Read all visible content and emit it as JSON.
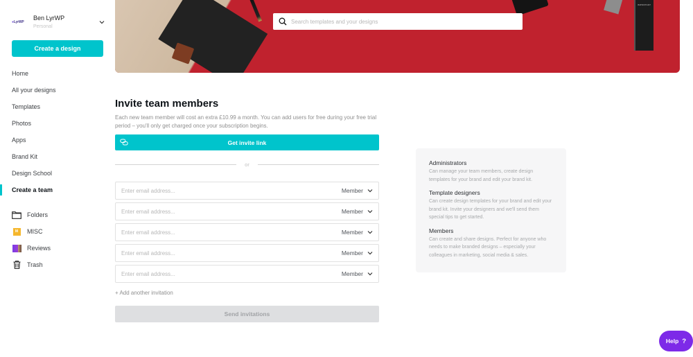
{
  "account": {
    "logo_text": "LyrWP",
    "name": "Ben LyrWP",
    "plan": "Personal"
  },
  "sidebar": {
    "create_button": "Create a design",
    "nav": [
      {
        "label": "Home",
        "active": false
      },
      {
        "label": "All your designs",
        "active": false
      },
      {
        "label": "Templates",
        "active": false
      },
      {
        "label": "Photos",
        "active": false
      },
      {
        "label": "Apps",
        "active": false
      },
      {
        "label": "Brand Kit",
        "active": false
      },
      {
        "label": "Design School",
        "active": false
      },
      {
        "label": "Create a team",
        "active": true
      }
    ],
    "folders": [
      {
        "label": "Folders",
        "icon": "folder-icon"
      },
      {
        "label": "MISC",
        "icon": "misc-thumbnail",
        "thumb_letter": "M"
      },
      {
        "label": "Reviews",
        "icon": "reviews-thumbnail"
      },
      {
        "label": "Trash",
        "icon": "trash-icon"
      }
    ]
  },
  "banner": {
    "search_placeholder": "Search templates and your designs",
    "search_value": "",
    "decor_label": "IMPORTANT"
  },
  "invite": {
    "title": "Invite team members",
    "description": "Each new team member will cost an extra £10.99 a month. You can add users for free during your free trial period – you'll only get charged once your subscription begins.",
    "invite_link_button": "Get invite link",
    "divider_text": "or",
    "rows": [
      {
        "placeholder": "Enter email address...",
        "value": "",
        "role": "Member"
      },
      {
        "placeholder": "Enter email address...",
        "value": "",
        "role": "Member"
      },
      {
        "placeholder": "Enter email address...",
        "value": "",
        "role": "Member"
      },
      {
        "placeholder": "Enter email address...",
        "value": "",
        "role": "Member"
      },
      {
        "placeholder": "Enter email address...",
        "value": "",
        "role": "Member"
      }
    ],
    "add_another": "+ Add another invitation",
    "send_button": "Send invitations"
  },
  "roles": [
    {
      "name": "Administrators",
      "description": "Can manage your team members, create design templates for your brand and edit your brand kit."
    },
    {
      "name": "Template designers",
      "description": "Can create design templates for your brand and edit your brand kit. Invite your designers and we'll send them special tips to get started."
    },
    {
      "name": "Members",
      "description": "Can create and share designs. Perfect for anyone who needs to make branded designs – especially your colleagues in marketing, social media & sales."
    }
  ],
  "help": {
    "label": "Help",
    "icon_text": "?"
  },
  "colors": {
    "accent": "#00c4cc",
    "help": "#7d2ae8",
    "banner": "#c0222e",
    "disabled_button": "#dedfe1"
  }
}
